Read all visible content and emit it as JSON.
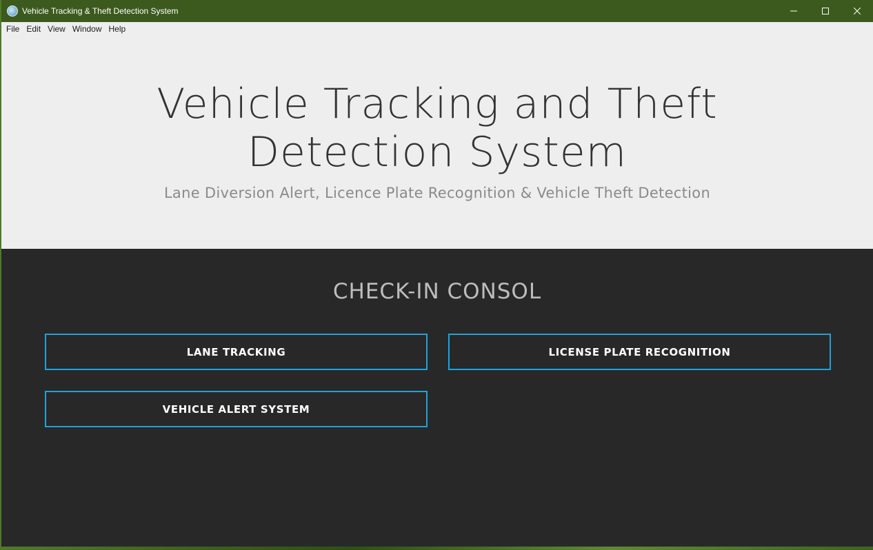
{
  "window": {
    "title": "Vehicle Tracking & Theft Detection System",
    "controls": {
      "minimize": "—",
      "maximize": "☐",
      "close": "✕"
    }
  },
  "menu": {
    "items": [
      {
        "label": "File"
      },
      {
        "label": "Edit"
      },
      {
        "label": "View"
      },
      {
        "label": "Window"
      },
      {
        "label": "Help"
      }
    ]
  },
  "hero": {
    "title_line1": "Vehicle Tracking and Theft",
    "title_line2": "Detection System",
    "subtitle": "Lane Diversion Alert, Licence Plate Recognition & Vehicle Theft Detection"
  },
  "console": {
    "title": "CHECK-IN CONSOL",
    "buttons": {
      "lane_tracking": "LANE TRACKING",
      "license_plate": "LICENSE PLATE RECOGNITION",
      "vehicle_alert": "VEHICLE ALERT SYSTEM"
    }
  },
  "colors": {
    "titlebar": "#3c5a1d",
    "hero_bg": "#eeeeee",
    "console_bg": "#282828",
    "button_border": "#1fa3dc"
  }
}
